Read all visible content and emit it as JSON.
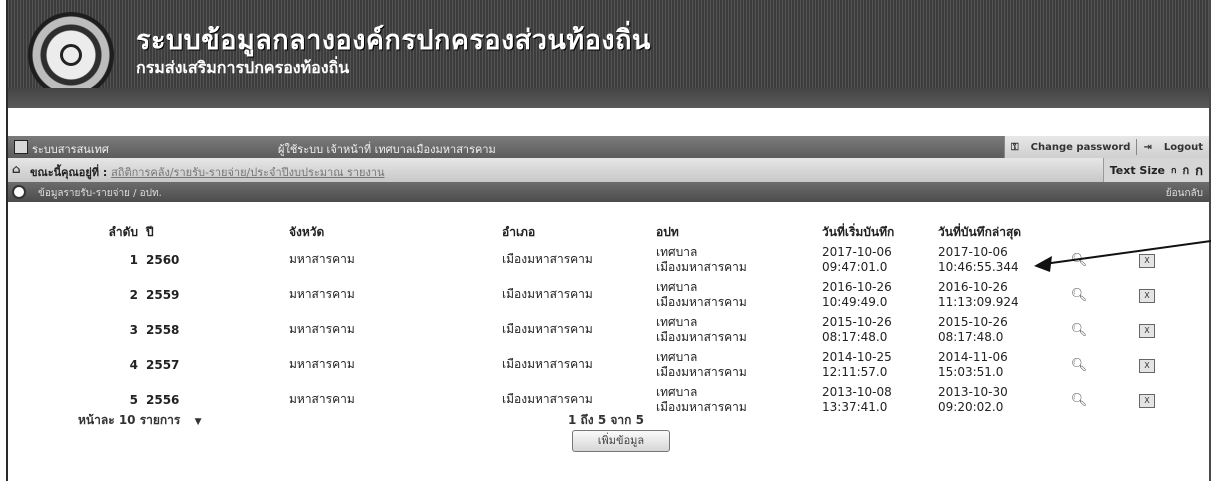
{
  "header": {
    "title": "ระบบข้อมูลกลางองค์กรปกครองส่วนท้องถิ่น",
    "subtitle": "กรมส่งเสริมการปกครองท้องถิ่น"
  },
  "menubar": {
    "menu_label": "ระบบสารสนเทศ",
    "user_info": "ผู้ใช้ระบบ เจ้าหน้าที่ เทศบาลเมืองมหาสารคาม",
    "change_password": "Change password",
    "logout": "Logout"
  },
  "breadcrumb": {
    "current": "ขณะนี้คุณอยู่ที่ :",
    "path": "สถิติการคลัง/รายรับ-รายจ่าย/ประจำปีงบประมาณ รายงาน",
    "text_size_label": "Text Size",
    "text_size_options": [
      "ก",
      "ก",
      "ก"
    ]
  },
  "section": {
    "title": "ข้อมูลรายรับ-รายจ่าย / อปท.",
    "right": "ย้อนกลับ"
  },
  "table": {
    "headers": [
      "ลำดับ",
      "ปี",
      "จังหวัด",
      "อำเภอ",
      "อปท",
      "วันที่เริ่มบันทึก",
      "วันที่บันทึกล่าสุด"
    ],
    "rows": [
      {
        "idx": "1",
        "year": "2560",
        "province": "มหาสารคาม",
        "district": "เมืองมหาสารคาม",
        "org1": "เทศบาล",
        "org2": "เมืองมหาสารคาม",
        "start_date": "2017-10-06",
        "start_time": "09:47:01.0",
        "last_date": "2017-10-06",
        "last_time": "10:46:55.344"
      },
      {
        "idx": "2",
        "year": "2559",
        "province": "มหาสารคาม",
        "district": "เมืองมหาสารคาม",
        "org1": "เทศบาล",
        "org2": "เมืองมหาสารคาม",
        "start_date": "2016-10-26",
        "start_time": "10:49:49.0",
        "last_date": "2016-10-26",
        "last_time": "11:13:09.924"
      },
      {
        "idx": "3",
        "year": "2558",
        "province": "มหาสารคาม",
        "district": "เมืองมหาสารคาม",
        "org1": "เทศบาล",
        "org2": "เมืองมหาสารคาม",
        "start_date": "2015-10-26",
        "start_time": "08:17:48.0",
        "last_date": "2015-10-26",
        "last_time": "08:17:48.0"
      },
      {
        "idx": "4",
        "year": "2557",
        "province": "มหาสารคาม",
        "district": "เมืองมหาสารคาม",
        "org1": "เทศบาล",
        "org2": "เมืองมหาสารคาม",
        "start_date": "2014-10-25",
        "start_time": "12:11:57.0",
        "last_date": "2014-11-06",
        "last_time": "15:03:51.0"
      },
      {
        "idx": "5",
        "year": "2556",
        "province": "มหาสารคาม",
        "district": "เมืองมหาสารคาม",
        "org1": "เทศบาล",
        "org2": "เมืองมหาสารคาม",
        "start_date": "2013-10-08",
        "start_time": "13:37:41.0",
        "last_date": "2013-10-30",
        "last_time": "09:20:02.0"
      }
    ],
    "icons": {
      "view": "search-icon",
      "export": "excel-icon"
    }
  },
  "pager": {
    "page_size": "หน้าละ 10 รายการ",
    "dropdown_glyph": "▼",
    "info": "1 ถึง 5 จาก 5",
    "more_button": "เพิ่มข้อมูล"
  },
  "colors": {
    "banner": "#4a4a4a",
    "menubar": "#6a6a6a",
    "sectionbar": "#555555"
  }
}
